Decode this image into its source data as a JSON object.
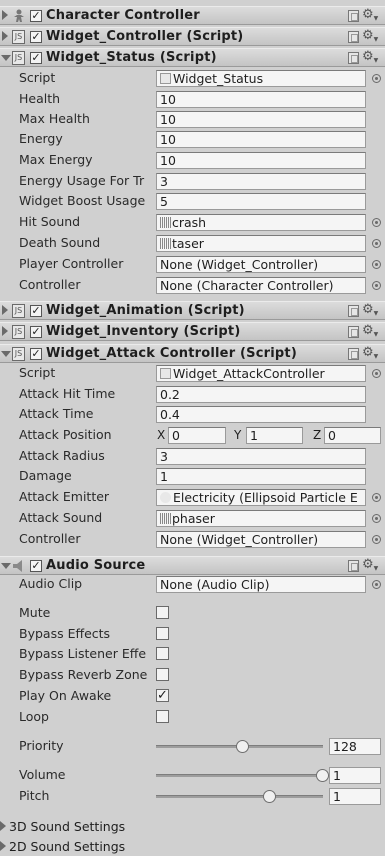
{
  "components": {
    "character_controller": {
      "title": "Character Controller"
    },
    "widget_controller": {
      "title": "Widget_Controller (Script)"
    },
    "widget_status": {
      "title": "Widget_Status (Script)",
      "fields": {
        "script": {
          "label": "Script",
          "value": "Widget_Status"
        },
        "health": {
          "label": "Health",
          "value": "10"
        },
        "max_health": {
          "label": "Max Health",
          "value": "10"
        },
        "energy": {
          "label": "Energy",
          "value": "10"
        },
        "max_energy": {
          "label": "Max Energy",
          "value": "10"
        },
        "energy_usage": {
          "label": "Energy Usage For Tr",
          "value": "3"
        },
        "widget_boost": {
          "label": "Widget Boost Usage",
          "value": "5"
        },
        "hit_sound": {
          "label": "Hit Sound",
          "value": "crash"
        },
        "death_sound": {
          "label": "Death Sound",
          "value": "taser"
        },
        "player_controller": {
          "label": "Player Controller",
          "value": "None (Widget_Controller)"
        },
        "controller": {
          "label": "Controller",
          "value": "None (Character Controller)"
        }
      }
    },
    "widget_animation": {
      "title": "Widget_Animation (Script)"
    },
    "widget_inventory": {
      "title": "Widget_Inventory (Script)"
    },
    "widget_attack": {
      "title": "Widget_Attack Controller (Script)",
      "fields": {
        "script": {
          "label": "Script",
          "value": "Widget_AttackController"
        },
        "attack_hit_time": {
          "label": "Attack Hit Time",
          "value": "0.2"
        },
        "attack_time": {
          "label": "Attack Time",
          "value": "0.4"
        },
        "attack_position": {
          "label": "Attack Position",
          "x_label": "X",
          "x": "0",
          "y_label": "Y",
          "y": "1",
          "z_label": "Z",
          "z": "0"
        },
        "attack_radius": {
          "label": "Attack Radius",
          "value": "3"
        },
        "damage": {
          "label": "Damage",
          "value": "1"
        },
        "attack_emitter": {
          "label": "Attack Emitter",
          "value": "Electricity (Ellipsoid Particle E"
        },
        "attack_sound": {
          "label": "Attack Sound",
          "value": "phaser"
        },
        "controller": {
          "label": "Controller",
          "value": "None (Widget_Controller)"
        }
      }
    },
    "audio_source": {
      "title": "Audio Source",
      "fields": {
        "audio_clip": {
          "label": "Audio Clip",
          "value": "None (Audio Clip)"
        },
        "mute": {
          "label": "Mute",
          "checked": false
        },
        "bypass_effects": {
          "label": "Bypass Effects",
          "checked": false
        },
        "bypass_listener": {
          "label": "Bypass Listener Effe",
          "checked": false
        },
        "bypass_reverb": {
          "label": "Bypass Reverb Zone",
          "checked": false
        },
        "play_on_awake": {
          "label": "Play On Awake",
          "checked": true,
          "mark": "✓"
        },
        "loop": {
          "label": "Loop",
          "checked": false
        },
        "priority": {
          "label": "Priority",
          "value": "128",
          "fraction": 0.5
        },
        "volume": {
          "label": "Volume",
          "value": "1",
          "fraction": 1.0
        },
        "pitch": {
          "label": "Pitch",
          "value": "1",
          "fraction": 0.667
        }
      },
      "foldouts": {
        "sound_3d": "3D Sound Settings",
        "sound_2d": "2D Sound Settings"
      }
    }
  },
  "icons": {
    "gear": "⚙",
    "dropdown": "▼",
    "check": "✓",
    "script": "JS"
  }
}
